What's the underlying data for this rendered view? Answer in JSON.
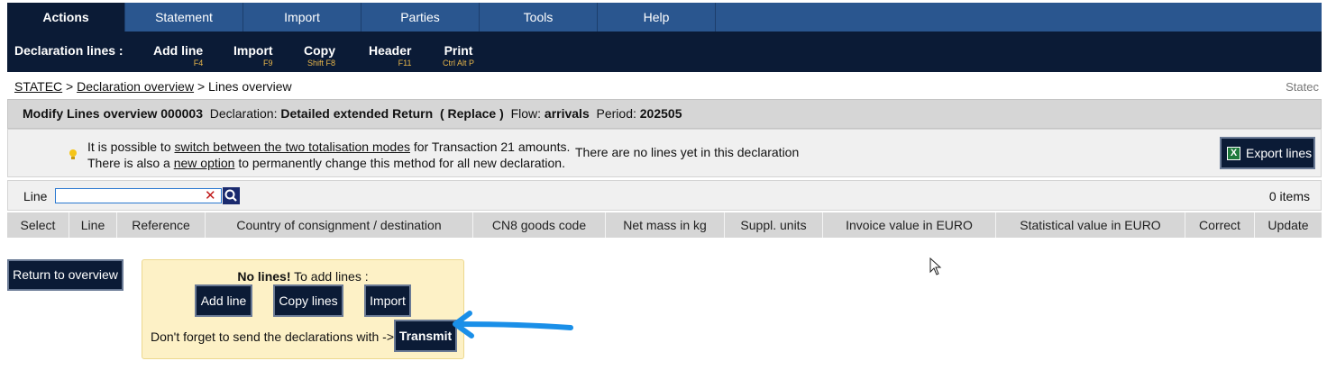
{
  "tabs": [
    "Actions",
    "Statement",
    "Import",
    "Parties",
    "Tools",
    "Help"
  ],
  "toolbar": {
    "title": "Declaration lines :",
    "items": [
      {
        "label": "Add line",
        "key": "F4"
      },
      {
        "label": "Import",
        "key": "F9"
      },
      {
        "label": "Copy",
        "key": "Shift F8"
      },
      {
        "label": "Header",
        "key": "F11"
      },
      {
        "label": "Print",
        "key": "Ctrl Alt P"
      }
    ]
  },
  "breadcrumb": {
    "root": "STATEC",
    "sep1": ">",
    "middle": "Declaration overview",
    "sep2": ">",
    "current": "Lines overview",
    "right": "Statec"
  },
  "heading": {
    "title": "Modify Lines overview 000003",
    "declaration_label": "Declaration:",
    "declaration_value": "Detailed extended Return",
    "mode": "( Replace )",
    "flow_label": "Flow:",
    "flow_value": "arrivals",
    "period_label": "Period:",
    "period_value": "202505"
  },
  "info": {
    "line1_pre": "It is possible to",
    "line1_link": "switch between the two totalisation modes",
    "line1_post": "for Transaction 21 amounts.",
    "line2_pre": "There is also a",
    "line2_link": "new option",
    "line2_post": "to permanently change this method for all new declaration.",
    "no_lines": "There are no lines yet in this declaration",
    "export_label": "Export lines",
    "bulb_icon": "lightbulb-icon",
    "excel_icon": "excel-icon"
  },
  "filter": {
    "label": "Line",
    "value": "",
    "clear_glyph": "✕",
    "count": "0 items"
  },
  "columns": [
    "Select",
    "Line",
    "Reference",
    "Country of consignment / destination",
    "CN8 goods code",
    "Net mass in kg",
    "Suppl. units",
    "Invoice value in EURO",
    "Statistical value in EURO",
    "Correct",
    "Update"
  ],
  "actions": {
    "return_label": "Return to overview",
    "hint_bold": "No lines!",
    "hint_rest": "To add lines :",
    "add_line": "Add line",
    "copy_lines": "Copy lines",
    "import": "Import",
    "reminder": "Don't forget to send the declarations with ->",
    "transmit": "Transmit"
  },
  "colors": {
    "navy": "#0b1b36",
    "tab_blue": "#2a568f",
    "key_gold": "#e8b64a",
    "panel_gray": "#d6d6d6",
    "hint_yellow": "#fdf1c6",
    "arrow_blue": "#1a8fe8"
  }
}
